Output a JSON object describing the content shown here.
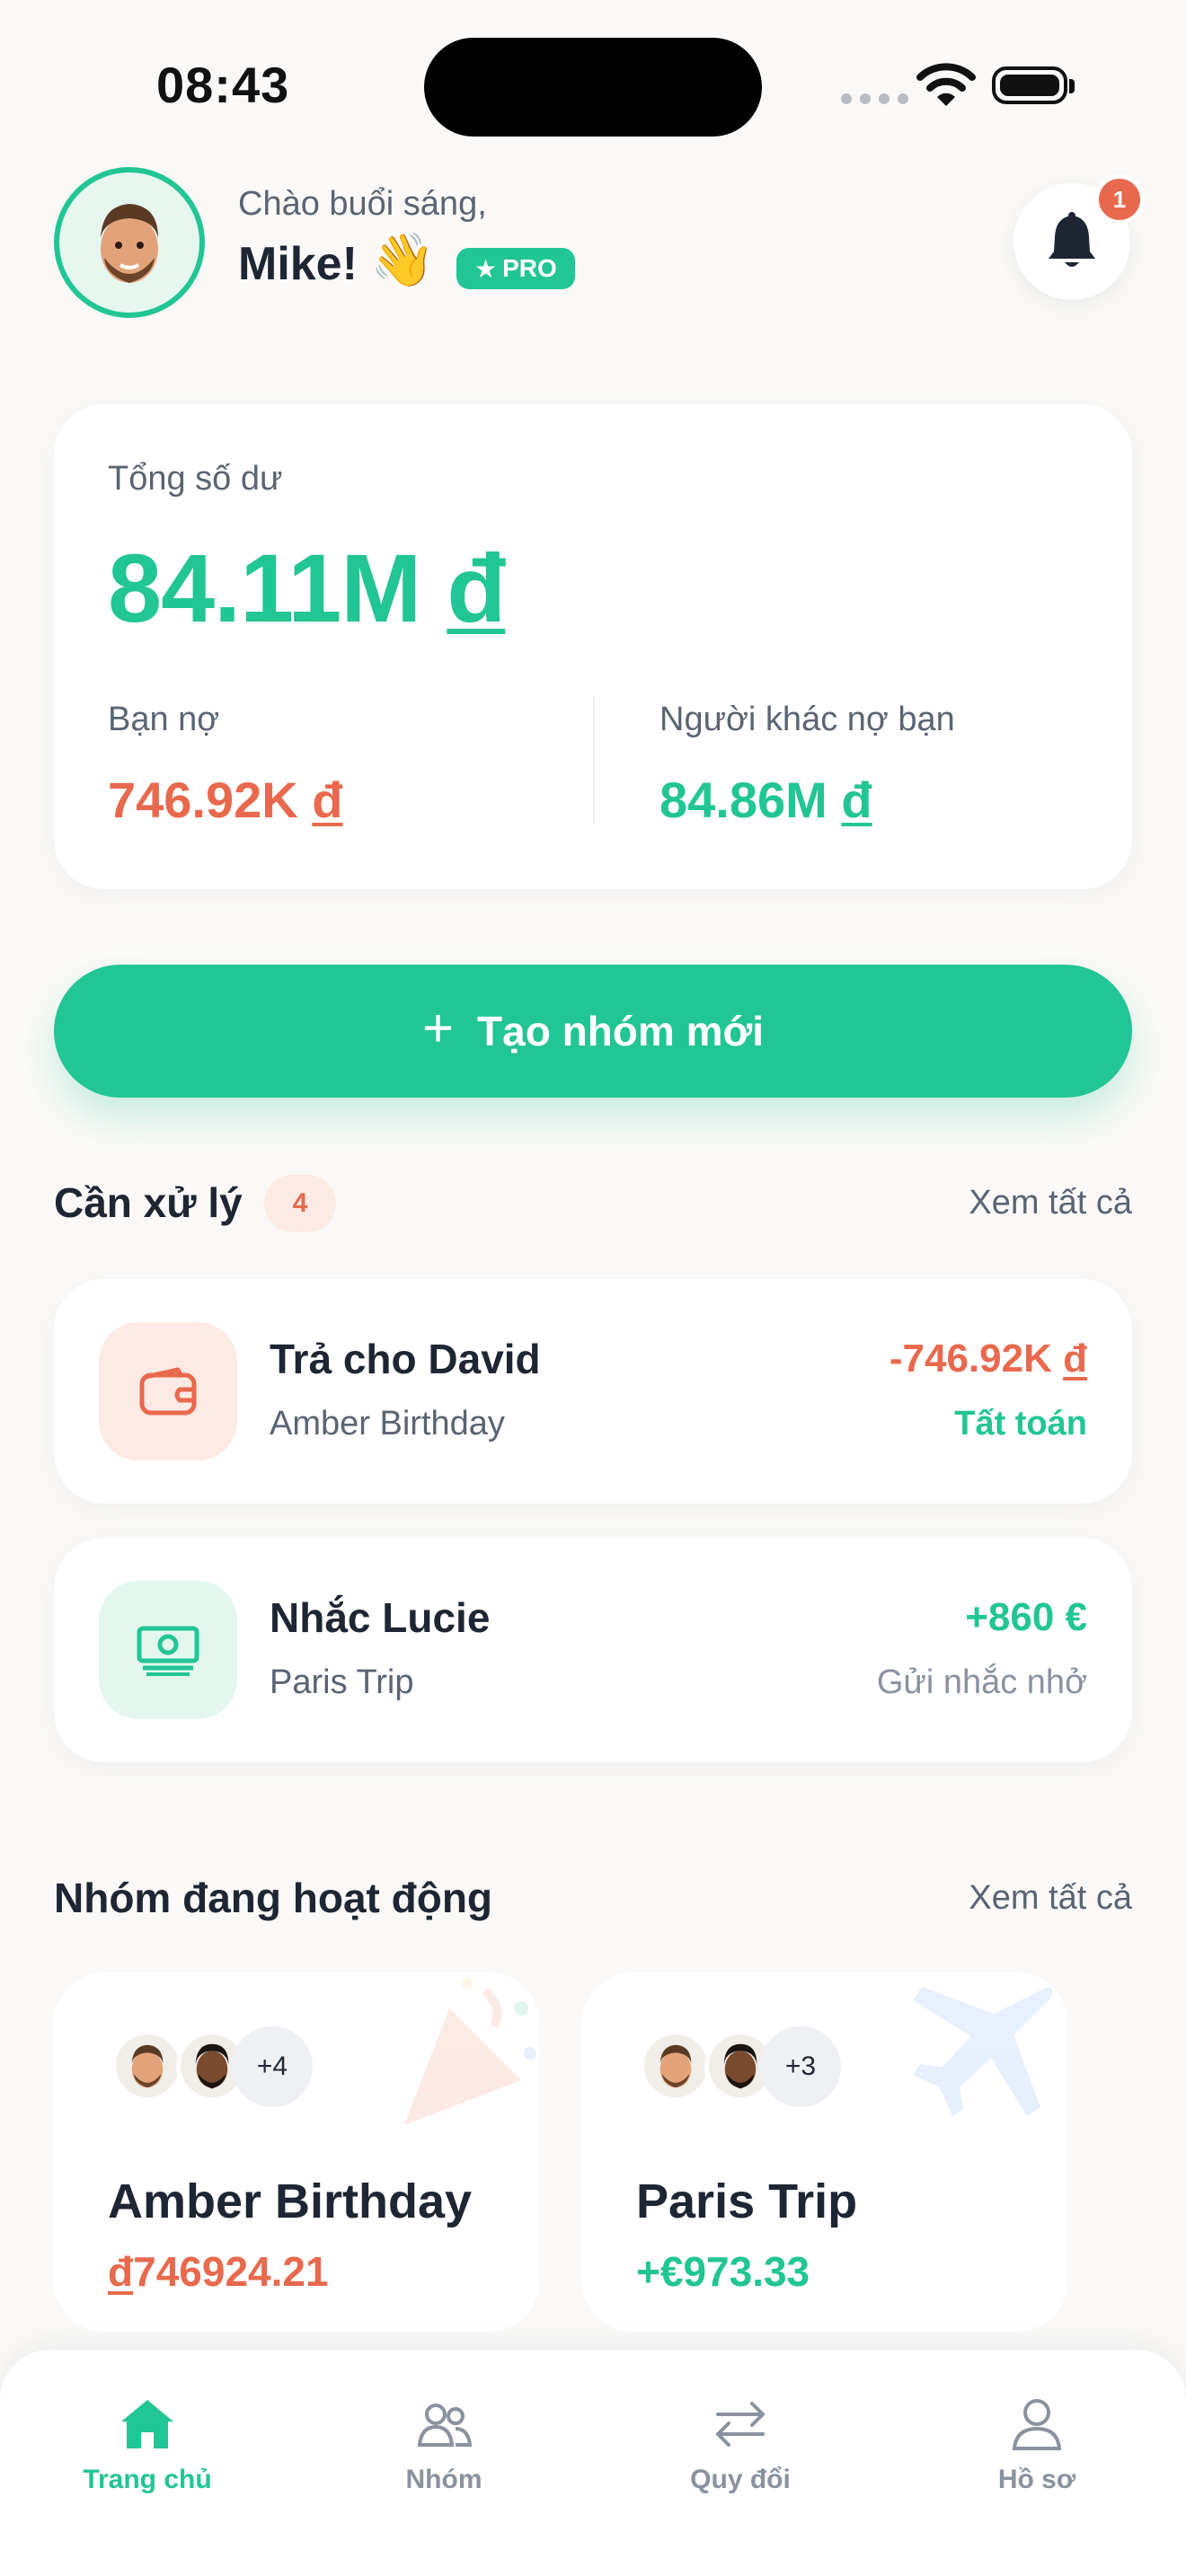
{
  "status_bar": {
    "time": "08:43"
  },
  "header": {
    "greeting": "Chào buổi sáng,",
    "name": "Mike!",
    "wave_emoji": "👋",
    "pro_label": "PRO",
    "notification_count": "1"
  },
  "balance": {
    "label": "Tổng số dư",
    "amount": "84.11M",
    "currency": "đ",
    "you_owe_label": "Bạn nợ",
    "you_owe_amount": "746.92K",
    "others_owe_label": "Người khác nợ bạn",
    "others_owe_amount": "84.86M"
  },
  "create_group": {
    "label": "Tạo nhóm mới"
  },
  "pending": {
    "title": "Cần xử lý",
    "count": "4",
    "see_all": "Xem tất cả",
    "items": [
      {
        "title": "Trả cho David",
        "subtitle": "Amber Birthday",
        "amount": "-746.92K",
        "currency": "đ",
        "action": "Tất toán",
        "icon": "wallet-icon"
      },
      {
        "title": "Nhắc Lucie",
        "subtitle": "Paris Trip",
        "amount": "+860 €",
        "action": "Gửi nhắc nhở",
        "icon": "cash-icon"
      }
    ]
  },
  "groups": {
    "title": "Nhóm đang hoạt động",
    "see_all": "Xem tất cả",
    "items": [
      {
        "name": "Amber Birthday",
        "amount": "746924.21",
        "currency": "đ",
        "more": "+4",
        "icon": "party-popper-icon"
      },
      {
        "name": "Paris Trip",
        "amount": "+€973.33",
        "more": "+3",
        "icon": "airplane-icon"
      }
    ]
  },
  "tabs": [
    {
      "label": "Trang chủ",
      "icon": "home-icon",
      "active": true
    },
    {
      "label": "Nhóm",
      "icon": "group-icon",
      "active": false
    },
    {
      "label": "Quy đổi",
      "icon": "exchange-icon",
      "active": false
    },
    {
      "label": "Hồ sơ",
      "icon": "profile-icon",
      "active": false
    }
  ],
  "colors": {
    "accent": "#22c594",
    "negative": "#e8694d",
    "text": "#1f2633",
    "muted": "#5b6473",
    "background": "#faf9f7"
  }
}
